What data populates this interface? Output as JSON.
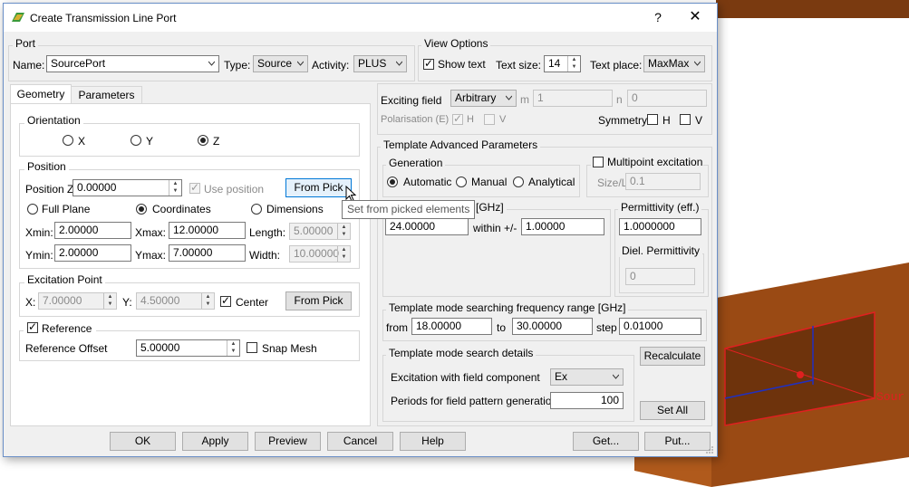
{
  "window": {
    "title": "Create Transmission Line Port",
    "help_label": "?",
    "close_label": "✕"
  },
  "scene": {
    "port_label": "Sour",
    "colors": {
      "box": "#9a4a14",
      "box_dark": "#7b3a0e",
      "edge": "#e02020",
      "axis": "#2030c0"
    }
  },
  "port": {
    "group_label": "Port",
    "name_label": "Name:",
    "name_value": "SourcePort",
    "type_label": "Type:",
    "type_value": "Source",
    "activity_label": "Activity:",
    "activity_value": "PLUS"
  },
  "view_options": {
    "group_label": "View Options",
    "show_text_label": "Show text",
    "show_text_checked": true,
    "text_size_label": "Text size:",
    "text_size_value": "14",
    "text_place_label": "Text place:",
    "text_place_value": "MaxMax"
  },
  "tabs": [
    {
      "label": "Geometry",
      "active": true
    },
    {
      "label": "Parameters",
      "active": false
    }
  ],
  "orientation": {
    "group_label": "Orientation",
    "options": [
      "X",
      "Y",
      "Z"
    ],
    "selected": "Z"
  },
  "position": {
    "group_label": "Position",
    "position_z_label": "Position Z",
    "position_z_value": "0.00000",
    "use_position_label": "Use position",
    "use_position_checked": true,
    "from_pick_label": "From Pick",
    "modes": [
      "Full Plane",
      "Coordinates",
      "Dimensions"
    ],
    "selected_mode": "Coordinates",
    "xmin_label": "Xmin:",
    "xmin_value": "2.00000",
    "xmax_label": "Xmax:",
    "xmax_value": "12.00000",
    "length_label": "Length:",
    "length_value": "5.00000",
    "ymin_label": "Ymin:",
    "ymin_value": "2.00000",
    "ymax_label": "Ymax:",
    "ymax_value": "7.00000",
    "width_label": "Width:",
    "width_value": "10.00000"
  },
  "excitation_point": {
    "group_label": "Excitation Point",
    "x_label": "X:",
    "x_value": "7.00000",
    "y_label": "Y:",
    "y_value": "4.50000",
    "center_label": "Center",
    "center_checked": true,
    "from_pick_label": "From Pick"
  },
  "reference": {
    "label": "Reference",
    "checked": true,
    "offset_label": "Reference Offset",
    "offset_value": "5.00000",
    "snap_mesh_label": "Snap Mesh",
    "snap_mesh_checked": false
  },
  "exciting": {
    "field_label": "Exciting field",
    "field_value": "Arbitrary",
    "m_label": "m",
    "m_value": "1",
    "n_label": "n",
    "n_value": "0",
    "polarisation_label": "Polarisation (E)",
    "pol_h_label": "H",
    "pol_h_checked": true,
    "pol_v_label": "V",
    "pol_v_checked": false,
    "symmetry_label": "Symmetry",
    "sym_h_label": "H",
    "sym_v_label": "V"
  },
  "template": {
    "group_label": "Template Advanced Parameters",
    "generation_label": "Generation",
    "generation_options": [
      "Automatic",
      "Manual",
      "Analytical"
    ],
    "generation_selected": "Automatic",
    "multipoint_label": "Multipoint excitation",
    "multipoint_checked": false,
    "size_l_label": "Size/L",
    "size_l_value": "0.1",
    "freq_label_visible": "[GHz]",
    "freq_value": "24.00000",
    "within_label": "within +/-",
    "within_value": "1.00000",
    "permittivity_label": "Permittivity (eff.)",
    "permittivity_value": "1.0000000",
    "diel_label": "Diel. Permittivity",
    "diel_value": "0"
  },
  "search_range": {
    "group_label": "Template mode searching frequency range [GHz]",
    "from_label": "from",
    "from_value": "18.00000",
    "to_label": "to",
    "to_value": "30.00000",
    "step_label": "step",
    "step_value": "0.01000"
  },
  "search_details": {
    "group_label": "Template mode search details",
    "field_component_label": "Excitation with field component",
    "field_component_value": "Ex",
    "periods_label": "Periods for field pattern generation",
    "periods_value": "100",
    "recalculate_label": "Recalculate",
    "set_all_label": "Set All"
  },
  "tooltip": {
    "text": "Set from picked elements"
  },
  "buttons": {
    "ok": "OK",
    "apply": "Apply",
    "preview": "Preview",
    "cancel": "Cancel",
    "help": "Help",
    "get": "Get...",
    "put": "Put..."
  }
}
